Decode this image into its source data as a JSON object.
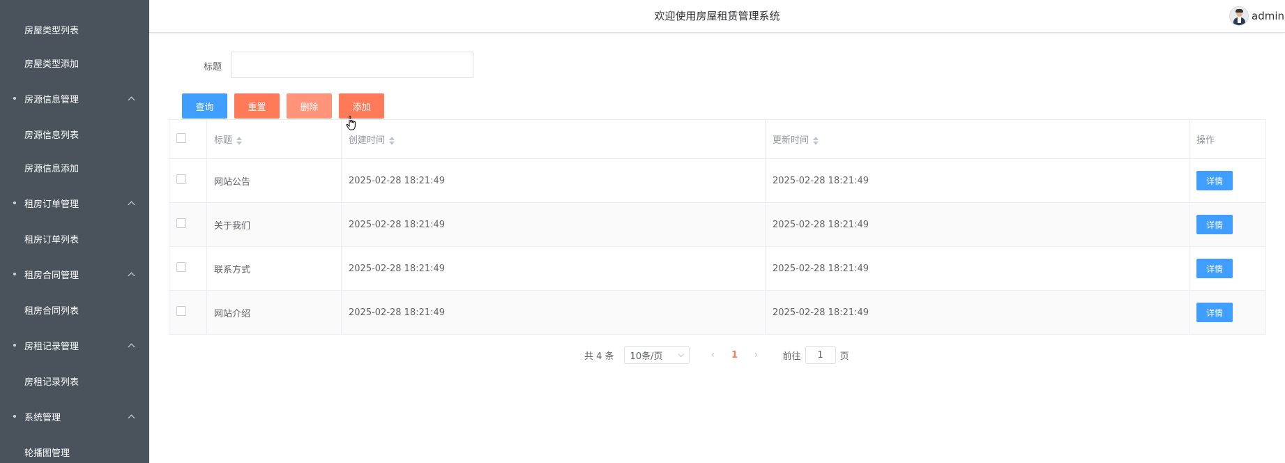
{
  "sidebar": {
    "items": [
      {
        "label": "房屋类型列表",
        "type": "sub"
      },
      {
        "label": "房屋类型添加",
        "type": "sub"
      },
      {
        "label": "房源信息管理",
        "type": "group"
      },
      {
        "label": "房源信息列表",
        "type": "sub"
      },
      {
        "label": "房源信息添加",
        "type": "sub"
      },
      {
        "label": "租房订单管理",
        "type": "group"
      },
      {
        "label": "租房订单列表",
        "type": "sub"
      },
      {
        "label": "租房合同管理",
        "type": "group"
      },
      {
        "label": "租房合同列表",
        "type": "sub"
      },
      {
        "label": "房租记录管理",
        "type": "group"
      },
      {
        "label": "房租记录列表",
        "type": "sub"
      },
      {
        "label": "系统管理",
        "type": "group"
      },
      {
        "label": "轮播图管理",
        "type": "sub"
      }
    ]
  },
  "header": {
    "title": "欢迎使用房屋租赁管理系统",
    "user": "admin"
  },
  "search": {
    "label": "标题",
    "value": "",
    "placeholder": ""
  },
  "toolbar": {
    "query_label": "查询",
    "reset_label": "重置",
    "delete_label": "删除",
    "add_label": "添加"
  },
  "table": {
    "headers": {
      "title": "标题",
      "created": "创建时间",
      "updated": "更新时间",
      "actions": "操作"
    },
    "rows": [
      {
        "title": "网站公告",
        "created": "2025-02-28 18:21:49",
        "updated": "2025-02-28 18:21:49",
        "action": "详情"
      },
      {
        "title": "关于我们",
        "created": "2025-02-28 18:21:49",
        "updated": "2025-02-28 18:21:49",
        "action": "详情"
      },
      {
        "title": "联系方式",
        "created": "2025-02-28 18:21:49",
        "updated": "2025-02-28 18:21:49",
        "action": "详情"
      },
      {
        "title": "网站介绍",
        "created": "2025-02-28 18:21:49",
        "updated": "2025-02-28 18:21:49",
        "action": "详情"
      }
    ]
  },
  "pagination": {
    "total": "共 4 条",
    "page_size": "10条/页",
    "current_page": "1",
    "goto_label": "前往",
    "goto_value": "1",
    "page_unit": "页"
  },
  "colors": {
    "sidebar_bg": "#4a525c",
    "primary": "#409eff",
    "accent": "#ff7a59"
  }
}
